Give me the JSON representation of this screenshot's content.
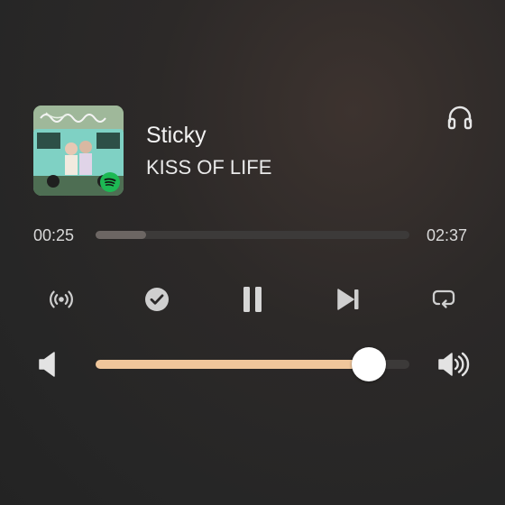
{
  "track": {
    "title": "Sticky",
    "artist": "KISS OF LIFE"
  },
  "album_art": {
    "badge_icon": "spotify-icon"
  },
  "progress": {
    "elapsed": "00:25",
    "total": "02:37",
    "fraction": 0.16
  },
  "volume": {
    "fraction": 0.87
  },
  "controls": {
    "output_device_icon": "headphones-icon",
    "cast_icon": "broadcast-icon",
    "saved_icon": "checkmark-circle-icon",
    "pause_icon": "pause-icon",
    "next_icon": "skip-next-icon",
    "repeat_icon": "repeat-icon",
    "volume_low_icon": "volume-mute-icon",
    "volume_high_icon": "volume-high-icon"
  },
  "colors": {
    "background": "#262626",
    "accent": "#f0c69b",
    "progress_fill": "#6c6663",
    "track_bg": "#3c3a39",
    "icon": "#cfcfcf",
    "spotify_green": "#1db954"
  }
}
